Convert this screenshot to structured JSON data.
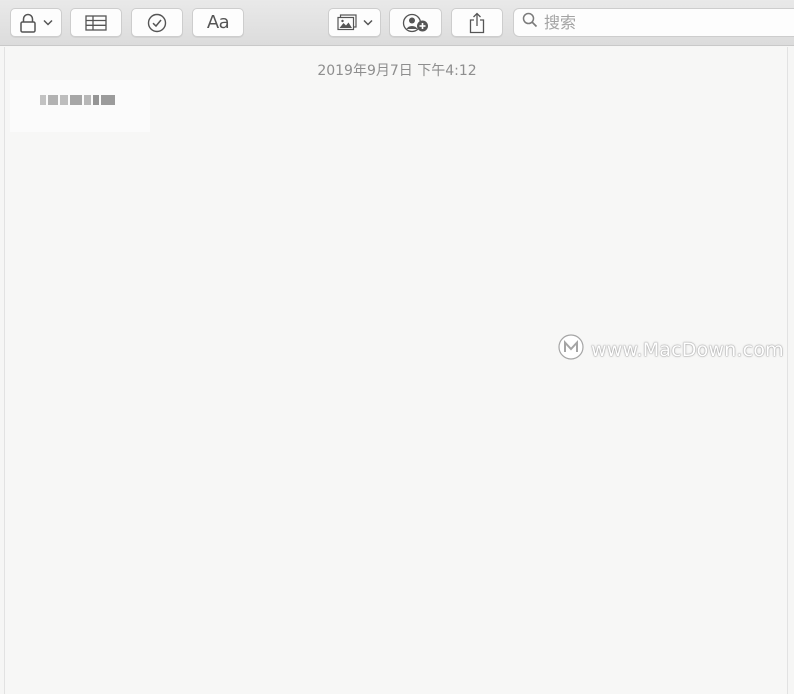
{
  "toolbar": {
    "lock_button": {
      "icon": "lock-icon",
      "has_dropdown": true
    },
    "table_button": {
      "icon": "table-icon"
    },
    "checklist_button": {
      "icon": "checkmark-circle-icon"
    },
    "format_button": {
      "label": "Aa"
    },
    "media_button": {
      "icon": "photo-icon",
      "has_dropdown": true
    },
    "collaborate_button": {
      "icon": "add-people-icon"
    },
    "share_button": {
      "icon": "share-icon"
    },
    "search": {
      "placeholder": "搜索",
      "value": ""
    }
  },
  "note": {
    "timestamp": "2019年9月7日 下午4:12",
    "body_text": "[blurred/pixelated text]"
  },
  "watermark": {
    "text": "www.MacDown.com",
    "logo": "macdown-logo"
  },
  "colors": {
    "paper": "#f7f7f6",
    "toolbar": "#e2e2e2",
    "timestamp": "#8e8e8e"
  }
}
